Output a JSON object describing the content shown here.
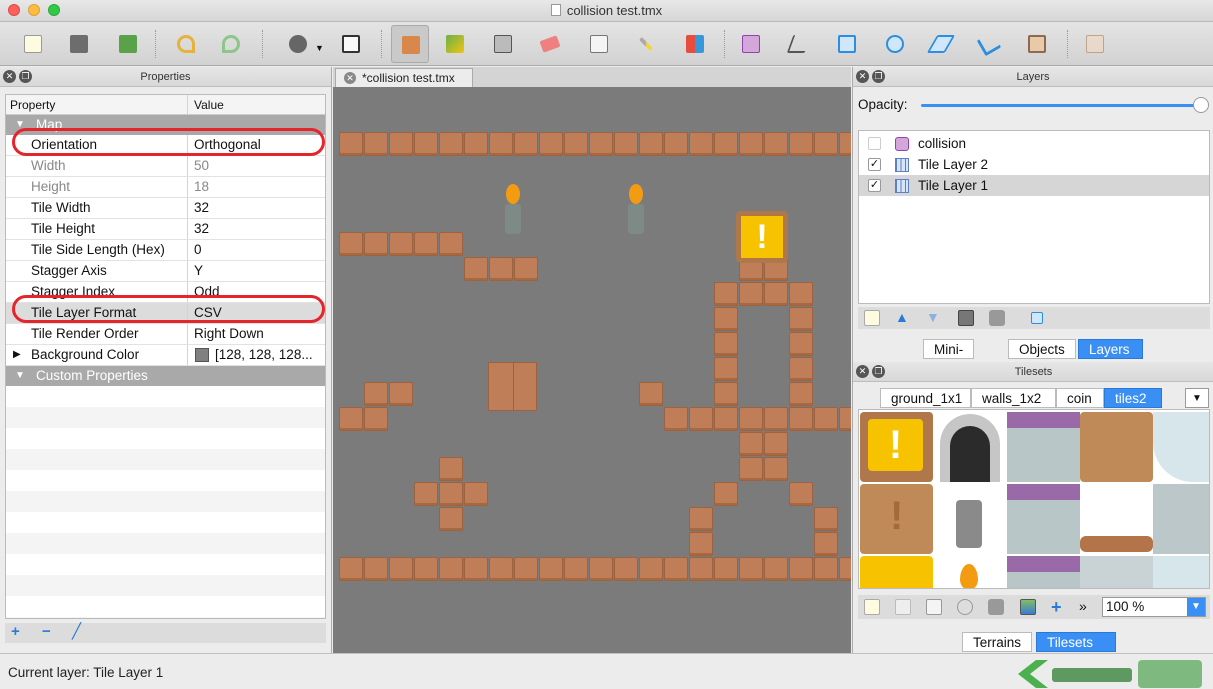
{
  "window": {
    "title": "collision test.tmx"
  },
  "toolbar": {
    "buttons": [
      "new-map-icon",
      "open-icon",
      "save-icon",
      "undo-icon",
      "redo-icon",
      "random-mode-icon",
      "dice-icon",
      "stamp-brush-icon",
      "terrain-brush-icon",
      "bucket-fill-icon",
      "eraser-icon",
      "rectangle-select-icon",
      "magic-wand-icon",
      "select-same-tile-icon",
      "select-objects-icon",
      "edit-polygons-icon",
      "insert-rectangle-icon",
      "insert-ellipse-icon",
      "insert-polygon-icon",
      "insert-polyline-icon",
      "insert-tile-icon",
      "insert-template-icon"
    ]
  },
  "properties": {
    "title": "Properties",
    "col_property": "Property",
    "col_value": "Value",
    "group_map": "Map",
    "rows": [
      {
        "name": "Orientation",
        "value": "Orthogonal"
      },
      {
        "name": "Width",
        "value": "50"
      },
      {
        "name": "Height",
        "value": "18"
      },
      {
        "name": "Tile Width",
        "value": "32"
      },
      {
        "name": "Tile Height",
        "value": "32"
      },
      {
        "name": "Tile Side Length (Hex)",
        "value": "0"
      },
      {
        "name": "Stagger Axis",
        "value": "Y"
      },
      {
        "name": "Stagger Index",
        "value": "Odd"
      },
      {
        "name": "Tile Layer Format",
        "value": "CSV"
      },
      {
        "name": "Tile Render Order",
        "value": "Right Down"
      },
      {
        "name": "Background Color",
        "value": "[128, 128, 128..."
      }
    ],
    "group_custom": "Custom Properties",
    "bg_swatch": "#808080"
  },
  "document": {
    "tab_label": "*collision test.tmx"
  },
  "layers": {
    "title": "Layers",
    "opacity_label": "Opacity:",
    "opacity_value": 1.0,
    "items": [
      {
        "name": "collision",
        "type": "object",
        "checked": false
      },
      {
        "name": "Tile Layer 2",
        "type": "tile",
        "checked": true
      },
      {
        "name": "Tile Layer 1",
        "type": "tile",
        "checked": true,
        "selected": true
      }
    ],
    "tabs": [
      "Mini-map",
      "Objects",
      "Layers"
    ],
    "active_tab": "Layers"
  },
  "tilesets": {
    "title": "Tilesets",
    "tabs": [
      "ground_1x1",
      "walls_1x2",
      "coin",
      "tiles2"
    ],
    "active_tab": "tiles2",
    "zoom": "100 %",
    "bottom_tabs": [
      "Terrains",
      "Tilesets"
    ],
    "active_bottom_tab": "Tilesets"
  },
  "status": {
    "current_layer": "Current layer: Tile Layer 1"
  },
  "colors": {
    "accent": "#3a8ff5",
    "highlight": "#e6242b",
    "tile": "#c07e58",
    "map_bg": "#7b7b7b"
  }
}
